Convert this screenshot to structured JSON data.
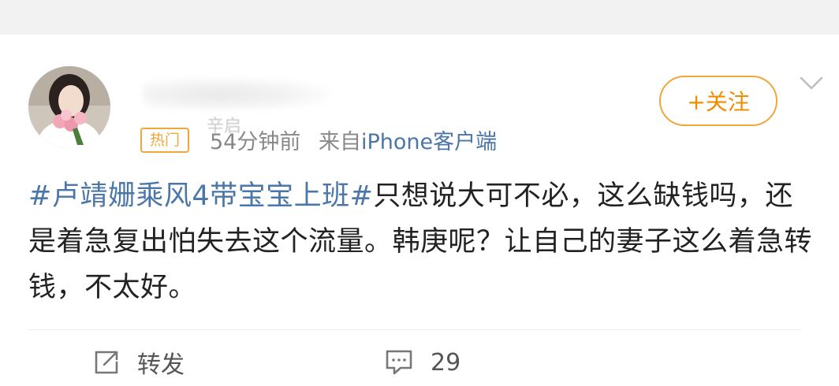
{
  "post": {
    "hot_badge": "热门",
    "username_fragment": "辛启",
    "time": "54分钟前",
    "source_prefix": "来自",
    "source": "iPhone客户端",
    "follow_label": "+关注",
    "hashtag": "#卢靖姗乘风4带宝宝上班#",
    "body": "只想说大可不必，这么缺钱吗，还是着急复出怕失去这个流量。韩庚呢？让自己的妻子这么着急转钱，不太好。"
  },
  "actions": {
    "repost_label": "转发",
    "comment_count": "29"
  },
  "icons": {
    "repost": "share-icon",
    "comment": "comment-icon",
    "more": "chevron-down-icon"
  },
  "colors": {
    "link_blue": "#4a76a8",
    "follow_orange": "#f08c00",
    "badge_orange": "#f1a63a",
    "meta_gray": "#888888"
  }
}
